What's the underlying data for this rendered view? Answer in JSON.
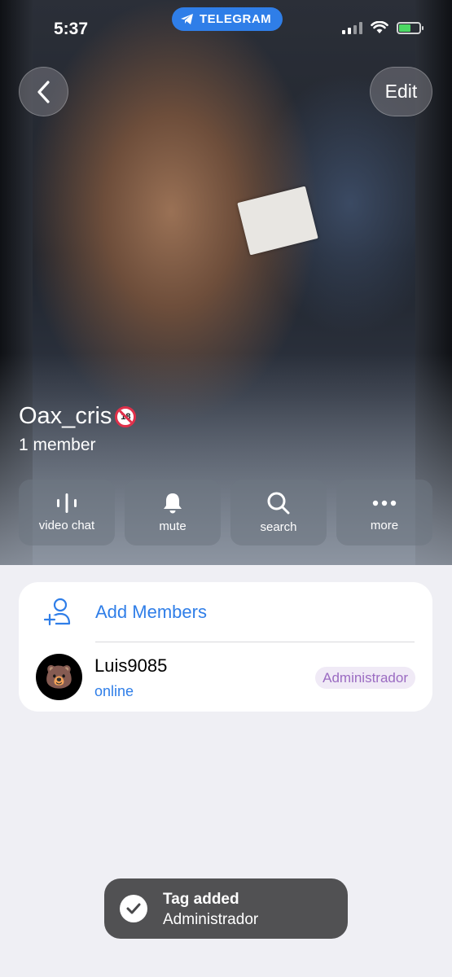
{
  "status_bar": {
    "time": "5:37",
    "return_app": "TELEGRAM",
    "icons": [
      "signal-icon",
      "wifi-icon",
      "battery-charging-icon"
    ]
  },
  "header": {
    "edit_label": "Edit",
    "back_icon": "chevron-left-icon"
  },
  "group": {
    "name": "Oax_cris",
    "name_badge": "18",
    "member_count": "1 member"
  },
  "actions": [
    {
      "label": "video chat",
      "icon": "voice-wave-icon"
    },
    {
      "label": "mute",
      "icon": "bell-icon"
    },
    {
      "label": "search",
      "icon": "search-icon"
    },
    {
      "label": "more",
      "icon": "ellipsis-icon"
    }
  ],
  "members": {
    "add_label": "Add Members",
    "list": [
      {
        "name": "Luis9085",
        "status": "online",
        "role": "Administrador",
        "avatar_emoji": "🐻"
      }
    ]
  },
  "toast": {
    "title": "Tag added",
    "subtitle": "Administrador"
  },
  "colors": {
    "accent": "#2f7ee8",
    "role_text": "#9b6bc2",
    "background": "#efeff4"
  }
}
